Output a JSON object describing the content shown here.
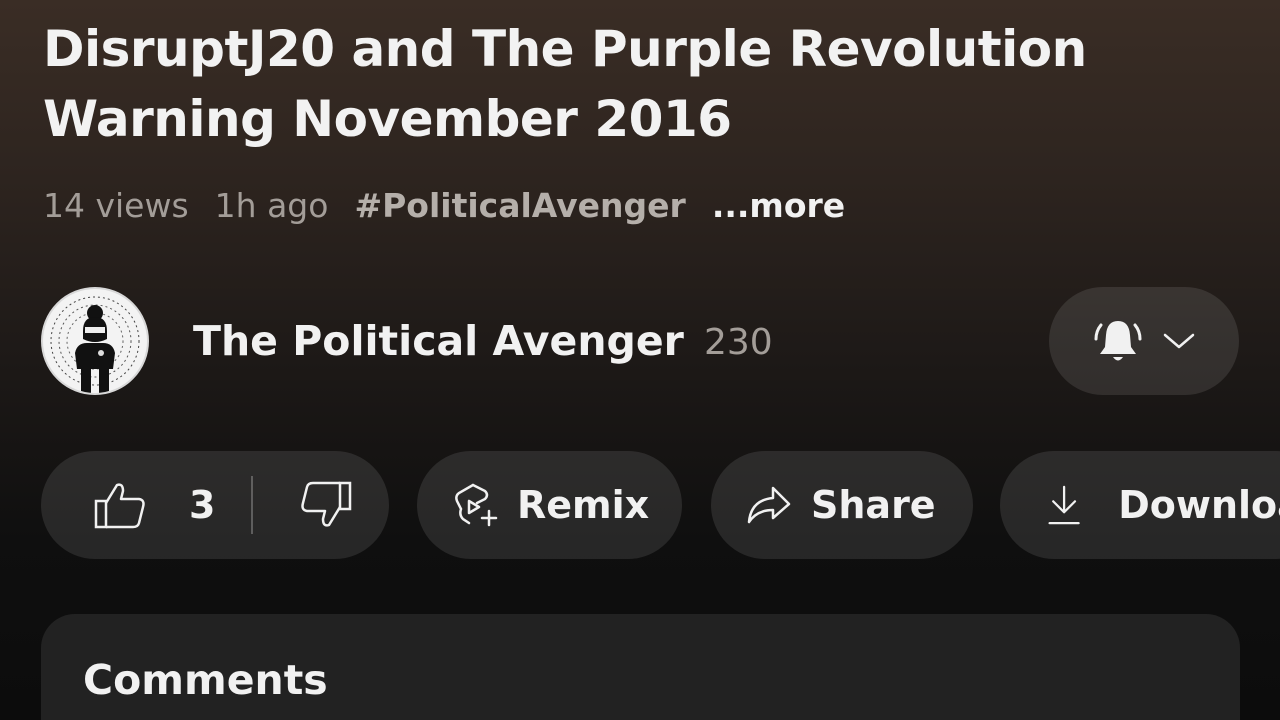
{
  "video": {
    "title_line1": "DisruptJ20 and The Purple Revolution",
    "title_line2": "Warning November 2016",
    "views": "14 views",
    "age": "1h ago",
    "hashtag": "#PoliticalAvenger",
    "more_label": "...more"
  },
  "channel": {
    "name": "The Political Avenger",
    "subscribers": "230",
    "avatar_icon": "channel-avatar-figure",
    "bell_icon": "bell-all-notifications-icon",
    "dropdown_icon": "chevron-down-icon"
  },
  "actions": {
    "like_count": "3",
    "remix_label": "Remix",
    "share_label": "Share",
    "download_label": "Download"
  },
  "comments": {
    "title": "Comments"
  },
  "colors": {
    "text_primary": "#f1f1f1",
    "text_secondary": "#a39d98",
    "pill_background": "rgba(255,255,255,0.1)",
    "comments_background": "#222222"
  }
}
